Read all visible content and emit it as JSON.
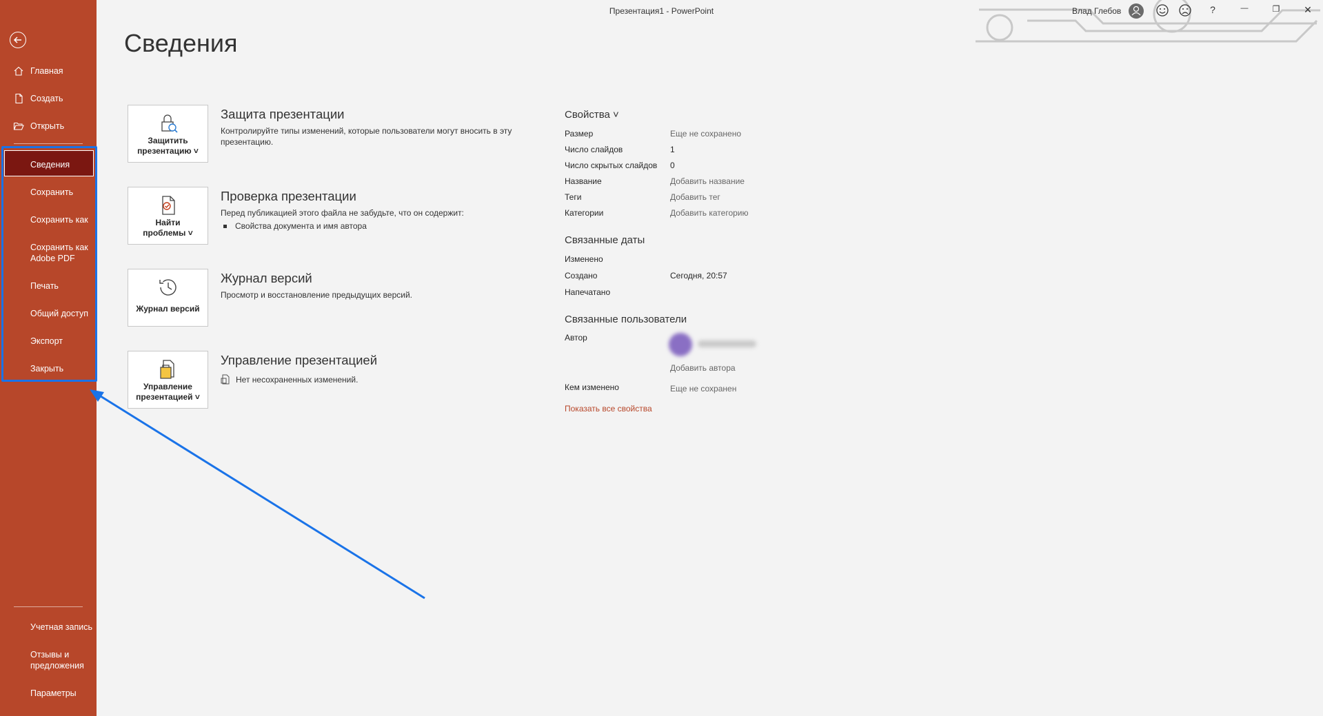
{
  "window": {
    "title": "Презентация1  -  PowerPoint",
    "user_name": "Влад Глебов",
    "help": "?",
    "minimize": "—",
    "restore": "❐",
    "close": "✕"
  },
  "sidebar": {
    "items": [
      {
        "label": "Главная"
      },
      {
        "label": "Создать"
      },
      {
        "label": "Открыть"
      },
      {
        "label": "Сведения"
      },
      {
        "label": "Сохранить"
      },
      {
        "label": "Сохранить как"
      },
      {
        "label": "Сохранить как",
        "label2": "Adobe PDF"
      },
      {
        "label": "Печать"
      },
      {
        "label": "Общий доступ"
      },
      {
        "label": "Экспорт"
      },
      {
        "label": "Закрыть"
      }
    ],
    "footer": [
      {
        "label": "Учетная запись"
      },
      {
        "label": "Отзывы и",
        "label2": "предложения"
      },
      {
        "label": "Параметры"
      }
    ]
  },
  "main": {
    "title": "Сведения",
    "sections": [
      {
        "tile_line1": "Защитить",
        "tile_line2": "презентацию ˅",
        "title": "Защита презентации",
        "desc1": "Контролируйте типы изменений, которые пользователи могут вносить в эту",
        "desc2": "презентацию."
      },
      {
        "tile_line1": "Найти",
        "tile_line2": "проблемы ˅",
        "title": "Проверка презентации",
        "desc1": "Перед публикацией этого файла не забудьте, что он содержит:",
        "bullet": "Свойства документа и имя автора"
      },
      {
        "tile_line1": "Журнал версий",
        "title": "Журнал версий",
        "desc1": "Просмотр и восстановление предыдущих версий."
      },
      {
        "tile_line1": "Управление",
        "tile_line2": "презентацией ˅",
        "title": "Управление презентацией",
        "desc1": "Нет несохраненных изменений."
      }
    ]
  },
  "properties": {
    "header": "Свойства ˅",
    "rows": [
      {
        "label": "Размер",
        "value": "Еще не сохранено"
      },
      {
        "label": "Число слайдов",
        "value": "1"
      },
      {
        "label": "Число скрытых слайдов",
        "value": "0"
      },
      {
        "label": "Название",
        "value": "Добавить название"
      },
      {
        "label": "Теги",
        "value": "Добавить тег"
      },
      {
        "label": "Категории",
        "value": "Добавить категорию"
      }
    ],
    "dates_header": "Связанные даты",
    "dates": [
      {
        "label": "Изменено",
        "value": ""
      },
      {
        "label": "Создано",
        "value": "Сегодня, 20:57"
      },
      {
        "label": "Напечатано",
        "value": ""
      }
    ],
    "people_header": "Связанные пользователи",
    "author_label": "Автор",
    "add_author": "Добавить автора",
    "modified_by_label": "Кем изменено",
    "modified_by_value": "Еще не сохранен",
    "show_all": "Показать все свойства"
  },
  "colors": {
    "sidebar": "#b7472a",
    "sidebar_active": "#7b1711",
    "annotation_blue": "#1a73e8"
  }
}
